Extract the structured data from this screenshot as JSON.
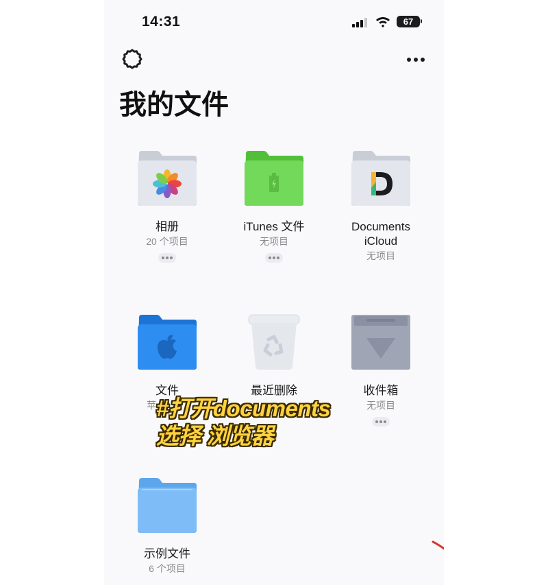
{
  "status_bar": {
    "time": "14:31",
    "battery": "67"
  },
  "header": {
    "title": "我的文件",
    "settings_icon": "gear-icon",
    "more_icon": "ellipsis-icon"
  },
  "items": [
    {
      "name": "相册",
      "count": "20 个项目",
      "icon": "photos-folder-icon",
      "color": "#dfe3ea"
    },
    {
      "name": "iTunes 文件",
      "count": "无项目",
      "icon": "itunes-folder-icon",
      "color": "#6fd64f"
    },
    {
      "name": "Documents\niCloud",
      "count": "无项目",
      "icon": "documents-folder-icon",
      "color": "#dfe3ea"
    },
    {
      "name": "文件",
      "count": "苹",
      "icon": "apple-folder-icon",
      "color": "#2d8cf0"
    },
    {
      "name": "最近删除",
      "count": "",
      "icon": "trash-icon",
      "color": "#e4e7ec"
    },
    {
      "name": "收件箱",
      "count": "无项目",
      "icon": "inbox-icon",
      "color": "#9ea3b4"
    },
    {
      "name": "示例文件",
      "count": "6 个项目",
      "icon": "folder-icon",
      "color": "#78b9f4"
    }
  ],
  "overlay_caption": {
    "line1": "#打开documents",
    "line2": "选择 浏览器"
  },
  "colors": {
    "caption_yellow": "#ffd23f",
    "annotation_red": "#d8322f"
  }
}
